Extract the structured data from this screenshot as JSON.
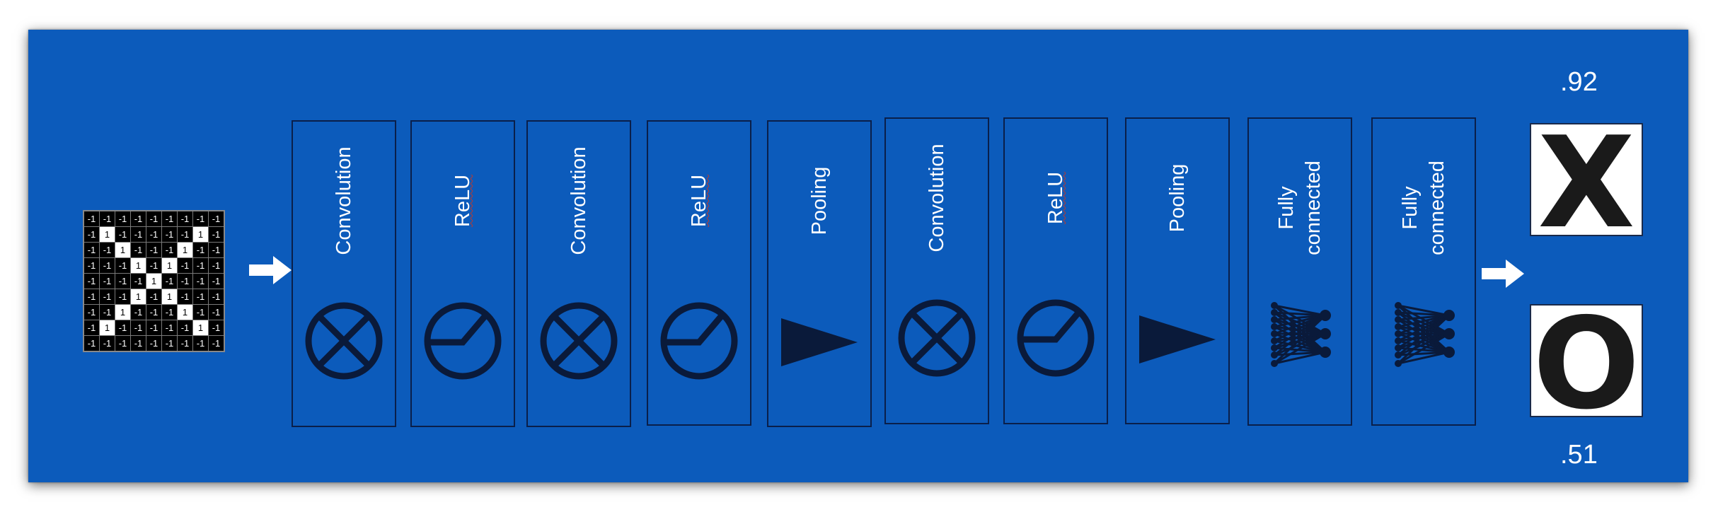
{
  "input": {
    "grid": [
      [
        "-1",
        "-1",
        "-1",
        "-1",
        "-1",
        "-1",
        "-1",
        "-1",
        "-1"
      ],
      [
        "-1",
        "1",
        "-1",
        "-1",
        "-1",
        "-1",
        "-1",
        "1",
        "-1"
      ],
      [
        "-1",
        "-1",
        "1",
        "-1",
        "-1",
        "-1",
        "1",
        "-1",
        "-1"
      ],
      [
        "-1",
        "-1",
        "-1",
        "1",
        "-1",
        "1",
        "-1",
        "-1",
        "-1"
      ],
      [
        "-1",
        "-1",
        "-1",
        "-1",
        "1",
        "-1",
        "-1",
        "-1",
        "-1"
      ],
      [
        "-1",
        "-1",
        "-1",
        "1",
        "-1",
        "1",
        "-1",
        "-1",
        "-1"
      ],
      [
        "-1",
        "-1",
        "1",
        "-1",
        "-1",
        "-1",
        "1",
        "-1",
        "-1"
      ],
      [
        "-1",
        "1",
        "-1",
        "-1",
        "-1",
        "-1",
        "-1",
        "1",
        "-1"
      ],
      [
        "-1",
        "-1",
        "-1",
        "-1",
        "-1",
        "-1",
        "-1",
        "-1",
        "-1"
      ]
    ]
  },
  "layers": [
    {
      "label": "Convolution",
      "icon": "convolution-icon"
    },
    {
      "label": "ReLU",
      "icon": "relu-icon"
    },
    {
      "label": "Convolution",
      "icon": "convolution-icon"
    },
    {
      "label": "ReLU",
      "icon": "relu-icon"
    },
    {
      "label": "Pooling",
      "icon": "pooling-icon"
    },
    {
      "label": "Convolution",
      "icon": "convolution-icon"
    },
    {
      "label": "ReLU",
      "icon": "relu-icon"
    },
    {
      "label": "Pooling",
      "icon": "pooling-icon"
    },
    {
      "label": "Fully connected",
      "icon": "neural-network-icon"
    },
    {
      "label": "Fully connected",
      "icon": "neural-network-icon"
    }
  ],
  "outputs": [
    {
      "letter": "X",
      "score": ".92"
    },
    {
      "letter": "O",
      "score": ".51"
    }
  ],
  "colors": {
    "background": "#0c5bbb",
    "outline": "#0a1f4a",
    "icon": "#0a1a3a",
    "text": "#ffffff"
  }
}
